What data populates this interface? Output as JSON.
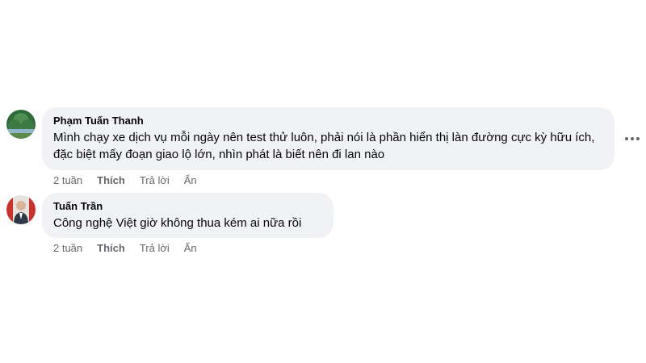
{
  "comments": [
    {
      "author": "Phạm Tuấn Thanh",
      "text": "Mình chạy xe dịch vụ mỗi ngày nên test thử luôn, phải nói là phần hiển thị làn đường cực kỳ hữu ích, đặc biệt mấy đoạn giao lộ lớn, nhìn phát là biết nên đi lan nào",
      "time": "2 tuần",
      "like_label": "Thích",
      "reply_label": "Trả lời",
      "hide_label": "Ẩn",
      "avatar_icon": "user-avatar-landscape-icon"
    },
    {
      "author": "Tuấn Trần",
      "text": "Công nghệ Việt giờ không thua kém ai nữa rồi",
      "time": "2 tuần",
      "like_label": "Thích",
      "reply_label": "Trả lời",
      "hide_label": "Ẩn",
      "avatar_icon": "user-avatar-person-icon"
    }
  ],
  "more_icon": "more-options-icon",
  "colors": {
    "bubble": "#f0f2f5",
    "meta_text": "#65676b",
    "text": "#050505"
  }
}
